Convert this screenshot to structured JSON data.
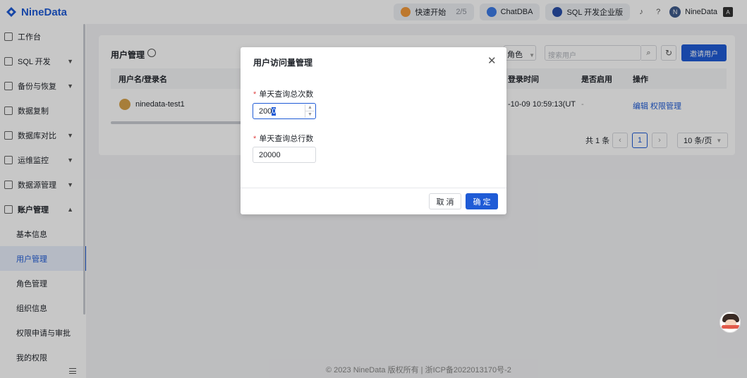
{
  "header": {
    "logo": "NineData",
    "quick_start_label": "快速开始",
    "quick_start_progress": "2/5",
    "chatdba_label": "ChatDBA",
    "edition_label": "SQL 开发企业版",
    "user_name": "NineData",
    "user_initial": "N"
  },
  "sidebar": {
    "items": [
      {
        "label": "工作台"
      },
      {
        "label": "SQL 开发"
      },
      {
        "label": "备份与恢复"
      },
      {
        "label": "数据复制"
      },
      {
        "label": "数据库对比"
      },
      {
        "label": "运维监控"
      },
      {
        "label": "数据源管理"
      },
      {
        "label": "账户管理"
      }
    ],
    "sub_items": [
      {
        "label": "基本信息"
      },
      {
        "label": "用户管理"
      },
      {
        "label": "角色管理"
      },
      {
        "label": "组织信息"
      },
      {
        "label": "权限申请与审批"
      },
      {
        "label": "我的权限"
      }
    ]
  },
  "main": {
    "title": "用户管理",
    "role_filter": "角色",
    "search_placeholder": "搜索用户",
    "invite_button": "邀请用户",
    "columns": [
      "用户名/登录名",
      "登录时间",
      "是否启用",
      "操作"
    ],
    "row": {
      "username": "ninedata-test1",
      "login_time": "-10-09 10:59:13(UT",
      "enabled": "-",
      "edit": "编辑",
      "permission": "权限管理"
    },
    "pagination": {
      "total": "共 1 条",
      "current": "1",
      "page_size": "10 条/页"
    }
  },
  "modal": {
    "title": "用户访问量管理",
    "field1_label": "单天查询总次数",
    "field1_value_prefix": "200",
    "field1_value_selected": "0",
    "field2_label": "单天查询总行数",
    "field2_value": "20000",
    "cancel": "取 消",
    "confirm": "确 定"
  },
  "footer": "© 2023 NineData 版权所有 | 浙ICP备2022013170号-2",
  "colors": {
    "brand": "#1f5bd6",
    "required": "#e04444"
  }
}
